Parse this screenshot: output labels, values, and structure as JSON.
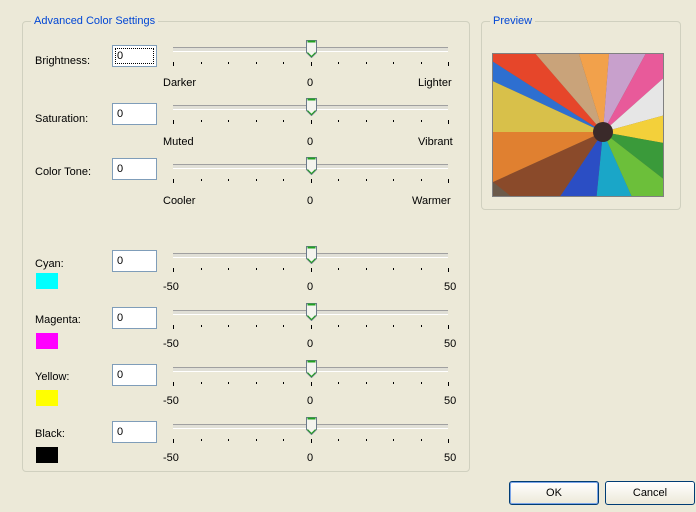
{
  "advanced": {
    "title": "Advanced Color Settings",
    "sliders": [
      {
        "label": "Brightness:",
        "value": "0",
        "level": 0,
        "min_label": "Darker",
        "mid_label": "0",
        "max_label": "Lighter"
      },
      {
        "label": "Saturation:",
        "value": "0",
        "level": 0,
        "min_label": "Muted",
        "mid_label": "0",
        "max_label": "Vibrant"
      },
      {
        "label": "Color Tone:",
        "value": "0",
        "level": 0,
        "min_label": "Cooler",
        "mid_label": "0",
        "max_label": "Warmer"
      },
      {
        "label": "Cyan:",
        "value": "0",
        "level": 0,
        "min_label": "-50",
        "mid_label": "0",
        "max_label": "50",
        "swatch": "#00ffff"
      },
      {
        "label": "Magenta:",
        "value": "0",
        "level": 0,
        "min_label": "-50",
        "mid_label": "0",
        "max_label": "50",
        "swatch": "#ff00ff"
      },
      {
        "label": "Yellow:",
        "value": "0",
        "level": 0,
        "min_label": "-50",
        "mid_label": "0",
        "max_label": "50",
        "swatch": "#ffff00"
      },
      {
        "label": "Black:",
        "value": "0",
        "level": 0,
        "min_label": "-50",
        "mid_label": "0",
        "max_label": "50",
        "swatch": "#000000"
      }
    ]
  },
  "preview": {
    "title": "Preview"
  },
  "buttons": {
    "ok": "OK",
    "cancel": "Cancel"
  },
  "colors": {
    "group_title": "#0046d5",
    "thumb_accent": "#21a121"
  }
}
